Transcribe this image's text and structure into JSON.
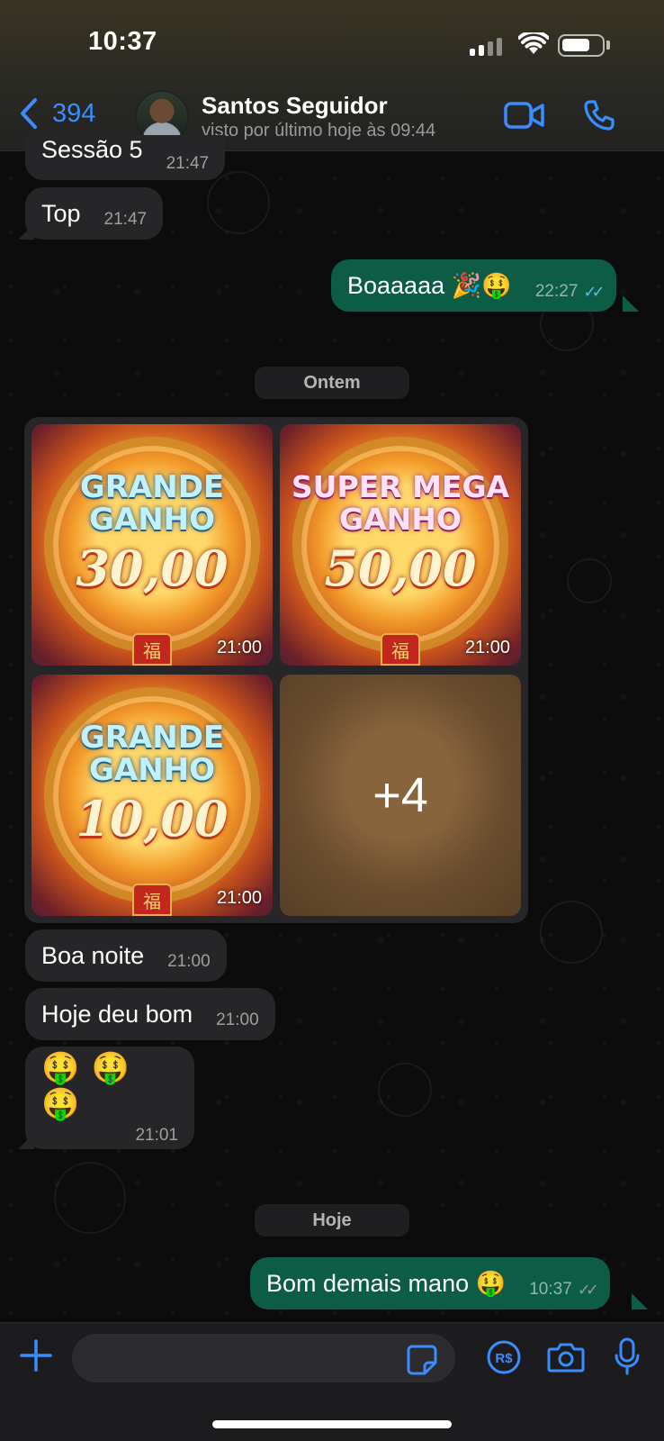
{
  "status_bar": {
    "time": "10:37"
  },
  "header": {
    "back_count": "394",
    "contact_name": "Santos Seguidor",
    "contact_status": "visto por último hoje às 09:44"
  },
  "messages": [
    {
      "direction": "in",
      "text": "Sessão 5",
      "time": "21:47"
    },
    {
      "direction": "in",
      "text": "Top",
      "time": "21:47"
    },
    {
      "direction": "out",
      "text": "Boaaaaa 🎉🤑",
      "time": "22:27",
      "status": "read"
    },
    {
      "type": "date",
      "text": "Ontem"
    },
    {
      "type": "album",
      "tiles": [
        {
          "headline": "GRANDE GANHO",
          "amount": "30,00",
          "time": "21:00"
        },
        {
          "headline": "SUPER MEGA GANHO",
          "amount": "50,00",
          "time": "21:00"
        },
        {
          "headline": "GRANDE GANHO",
          "amount": "10,00",
          "time": "21:00"
        },
        {
          "more": "+4"
        }
      ]
    },
    {
      "direction": "in",
      "text": "Boa noite",
      "time": "21:00"
    },
    {
      "direction": "in",
      "text": "Hoje deu bom",
      "time": "21:00"
    },
    {
      "direction": "in",
      "text": "🤑 🤑 🤑",
      "time": "21:01"
    },
    {
      "type": "date",
      "text": "Hoje"
    },
    {
      "direction": "out",
      "text": "Bom demais mano 🤑",
      "time": "10:37",
      "status": "delivered"
    }
  ],
  "tile_stamp": "福",
  "colors": {
    "accent": "#3a8dff",
    "outgoing_bubble": "#0d5c46",
    "incoming_bubble": "#262628",
    "read_tick": "#53bdeb"
  }
}
